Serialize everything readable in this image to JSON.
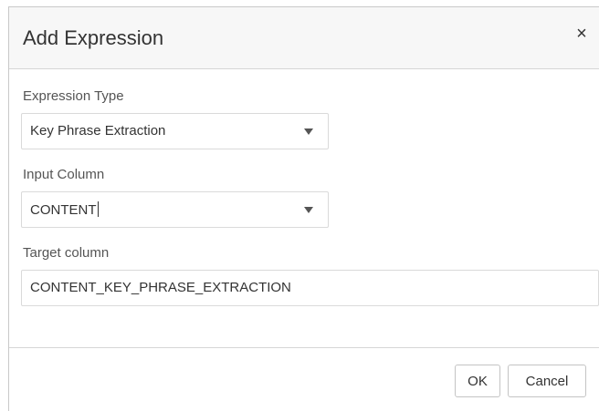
{
  "dialog": {
    "title": "Add Expression",
    "close_icon": "close-icon",
    "close_glyph": "×"
  },
  "fields": {
    "expression_type": {
      "label": "Expression Type",
      "value": "Key Phrase Extraction",
      "icon": "chevron-down-icon"
    },
    "input_column": {
      "label": "Input Column",
      "value": "CONTENT",
      "icon": "chevron-down-icon"
    },
    "target_column": {
      "label": "Target column",
      "value": "CONTENT_KEY_PHRASE_EXTRACTION"
    }
  },
  "buttons": {
    "ok_label": "OK",
    "cancel_label": "Cancel"
  },
  "colors": {
    "header_bg": "#f7f7f7",
    "border": "#dadada",
    "text": "#333333",
    "label_text": "#555555"
  }
}
